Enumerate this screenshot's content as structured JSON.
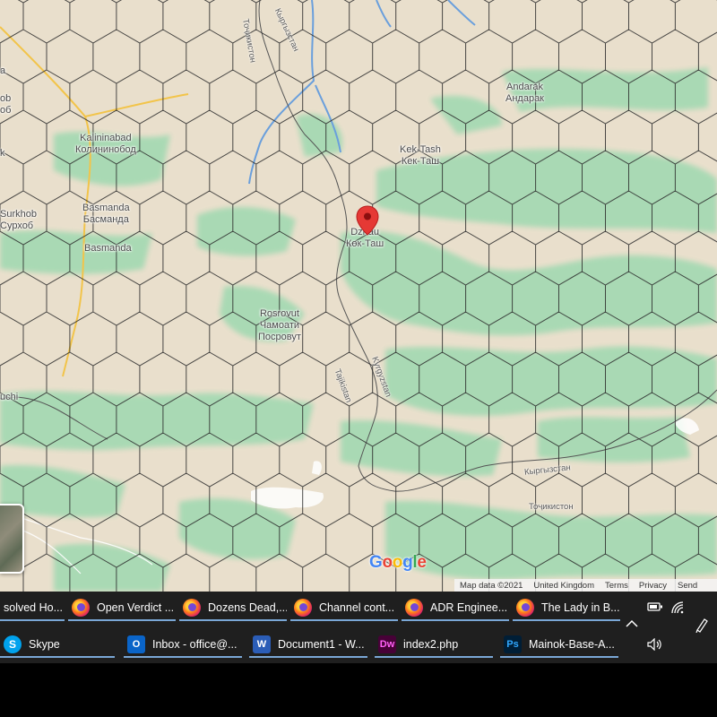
{
  "map": {
    "places": [
      {
        "id": "kalininabad",
        "lines": [
          "Kalininabad",
          "Колининобод"
        ]
      },
      {
        "id": "basmanda1",
        "lines": [
          "Basmanda",
          "Басманда"
        ]
      },
      {
        "id": "basmanda2",
        "lines": [
          "Basmanda"
        ]
      },
      {
        "id": "surkhob",
        "lines": [
          "Surkhob",
          "Сурхоб"
        ]
      },
      {
        "id": "andarak",
        "lines": [
          "Andarak",
          "Андарак"
        ]
      },
      {
        "id": "koktash",
        "lines": [
          "Kek-Tash",
          "Кек-Таш"
        ]
      },
      {
        "id": "dzhau",
        "lines": [
          "Dzhau",
          "Көк-Таш"
        ]
      },
      {
        "id": "rosrovut",
        "lines": [
          "Rosrovut",
          "Чамоати",
          "Посровут"
        ]
      },
      {
        "id": "left_a",
        "lines": [
          "a"
        ]
      },
      {
        "id": "left_ob",
        "lines": [
          "ob",
          "об"
        ]
      },
      {
        "id": "left_k",
        "lines": [
          "k"
        ]
      },
      {
        "id": "uchi",
        "lines": [
          "uchi"
        ]
      }
    ],
    "rotated_labels": [
      {
        "id": "tojikiston_top",
        "text": "Тоҷикистон"
      },
      {
        "id": "kyrgyzstan_top",
        "text": "Кыргызстан"
      },
      {
        "id": "tajikistan",
        "text": "Tajikistan"
      },
      {
        "id": "kyrgyzstan",
        "text": "Kyrgyzstan"
      },
      {
        "id": "kyrgyzstan_cyr",
        "text": "Кыргызстан"
      },
      {
        "id": "tojikiston_bottom",
        "text": "Тоҷикистон"
      }
    ],
    "logo": [
      "G",
      "o",
      "o",
      "g",
      "l",
      "e"
    ],
    "attribution": {
      "map_data": "Map data ©2021",
      "region": "United Kingdom",
      "terms": "Terms",
      "privacy": "Privacy",
      "send": "Send"
    },
    "marker_icon": "map-pin-icon",
    "colors": {
      "land": "#e9dfcc",
      "forest": "#a6d9b3",
      "river": "#6a9fdc",
      "road": "#f2c44a",
      "hex": "#2c2c2c",
      "marker": "#e53935"
    }
  },
  "taskbar": {
    "row1": [
      {
        "label": "solved Ho...",
        "icon": "none"
      },
      {
        "label": "Open Verdict ...",
        "icon": "firefox-icon"
      },
      {
        "label": "Dozens Dead,...",
        "icon": "firefox-icon"
      },
      {
        "label": "Channel cont...",
        "icon": "firefox-icon"
      },
      {
        "label": "ADR Enginee...",
        "icon": "firefox-icon"
      },
      {
        "label": "The Lady in B...",
        "icon": "firefox-icon"
      }
    ],
    "row2": [
      {
        "label": "Skype",
        "icon": "skype-icon",
        "glyph": "S"
      },
      {
        "label": "Inbox - office@...",
        "icon": "outlook-icon",
        "glyph": "O"
      },
      {
        "label": "Document1 - W...",
        "icon": "word-icon",
        "glyph": "W"
      },
      {
        "label": "index2.php",
        "icon": "dreamweaver-icon",
        "glyph": "Dw"
      },
      {
        "label": "Mainok-Base-A...",
        "icon": "photoshop-icon",
        "glyph": "Ps"
      }
    ]
  }
}
